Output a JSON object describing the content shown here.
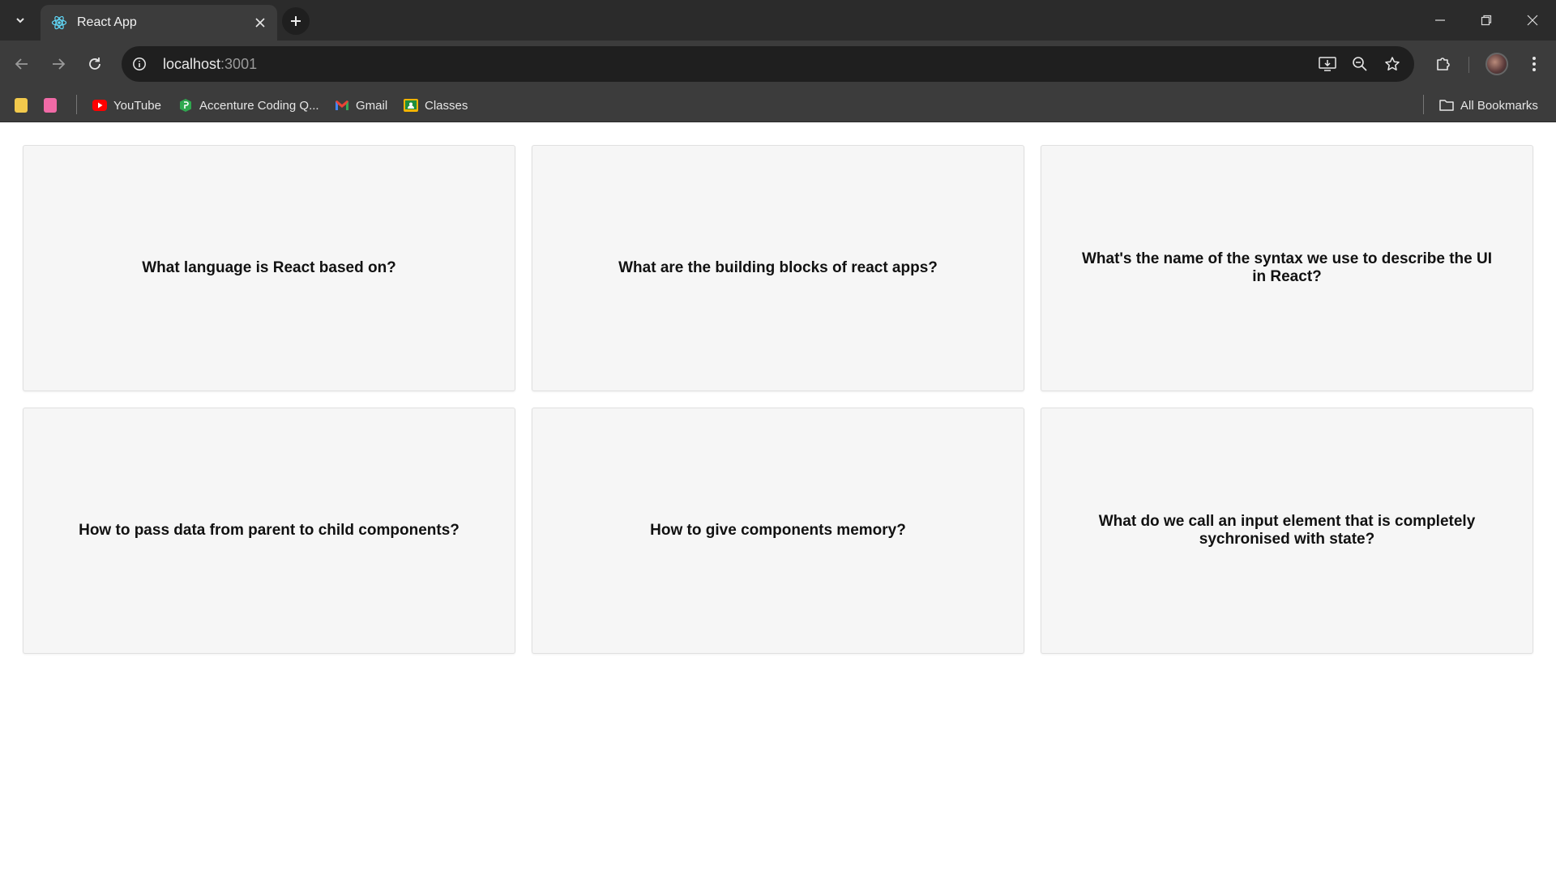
{
  "browser": {
    "tab": {
      "title": "React App",
      "favicon": "react-logo-icon"
    },
    "address": {
      "host": "localhost",
      "port": ":3001"
    },
    "bookmarks": [
      {
        "label": "",
        "icon": "yellow-square-icon"
      },
      {
        "label": "",
        "icon": "pink-square-icon"
      },
      {
        "label": "YouTube",
        "icon": "youtube-icon"
      },
      {
        "label": "Accenture Coding Q...",
        "icon": "accenture-icon"
      },
      {
        "label": "Gmail",
        "icon": "gmail-icon"
      },
      {
        "label": "Classes",
        "icon": "classroom-icon"
      }
    ],
    "all_bookmarks_label": "All Bookmarks"
  },
  "flashcards": [
    {
      "question": "What language is React based on?"
    },
    {
      "question": "What are the building blocks of react apps?"
    },
    {
      "question": "What's the name of the syntax we use to describe the UI in React?"
    },
    {
      "question": "How to pass data from parent to child components?"
    },
    {
      "question": "How to give components memory?"
    },
    {
      "question": "What do we call an input element that is completely sychronised with state?"
    }
  ],
  "colors": {
    "card_bg": "#f6f6f6",
    "chrome_dark": "#2b2b2b",
    "chrome": "#3c3c3c"
  }
}
